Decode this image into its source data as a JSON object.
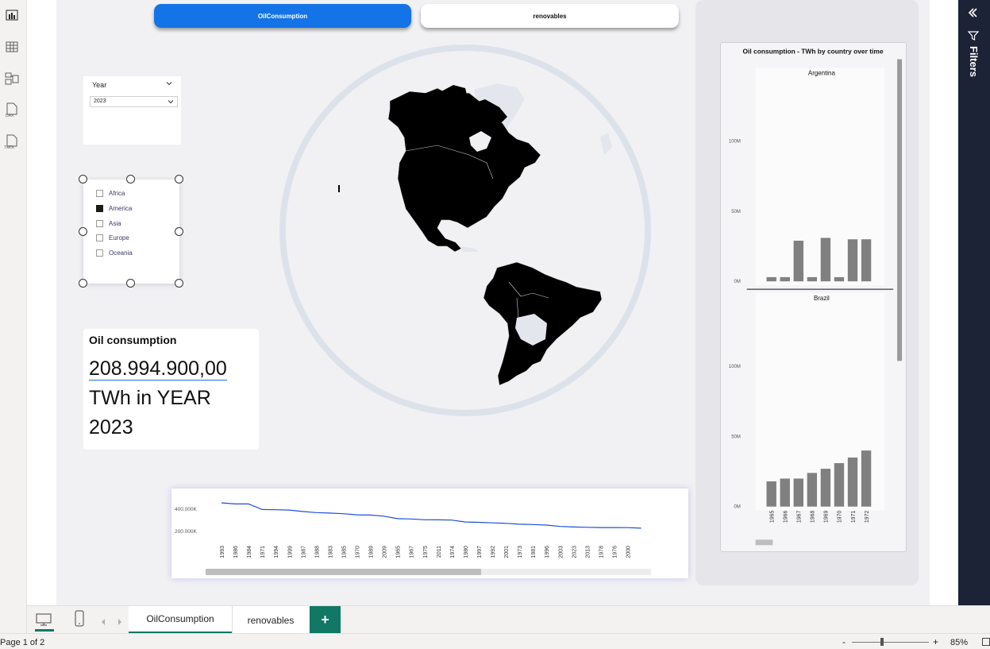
{
  "nav": {
    "active_tab": "OilConsumption",
    "other_tab": "renovables"
  },
  "slicer_year": {
    "title": "Year",
    "selected": "2023"
  },
  "slicer_region": {
    "items": [
      {
        "label": "Africa",
        "checked": false
      },
      {
        "label": "America",
        "checked": true
      },
      {
        "label": "Asia",
        "checked": false
      },
      {
        "label": "Europe",
        "checked": false
      },
      {
        "label": "Oceania",
        "checked": false
      }
    ]
  },
  "card": {
    "title": "Oil consumption",
    "value": "208.994.900,00",
    "suffix_1": "TWh in YEAR",
    "suffix_2": "2023"
  },
  "filters": {
    "label": "Filters"
  },
  "tabs": {
    "tab1": "OilConsumption",
    "tab2": "renovables",
    "add": "+"
  },
  "status": {
    "page": "Page 1 of 2",
    "zoom": "85%",
    "minus": "-",
    "plus": "+"
  },
  "chart_data": [
    {
      "type": "line",
      "title": "",
      "x": [
        "1993",
        "1986",
        "1984",
        "1971",
        "1994",
        "1999",
        "1987",
        "1988",
        "1983",
        "1985",
        "1970",
        "1989",
        "2009",
        "1965",
        "1967",
        "1975",
        "2011",
        "1974",
        "1980",
        "1997",
        "1992",
        "2001",
        "1973",
        "1981",
        "1996",
        "2003",
        "2023",
        "2013",
        "1978",
        "1976",
        "2000"
      ],
      "y": [
        450000,
        440000,
        440000,
        390000,
        388000,
        385000,
        372000,
        362000,
        358000,
        352000,
        342000,
        340000,
        330000,
        308000,
        305000,
        298000,
        297000,
        295000,
        278000,
        275000,
        270000,
        266000,
        258000,
        255000,
        250000,
        238000,
        233000,
        230000,
        228000,
        228000,
        227000,
        222000
      ],
      "yticks": [
        "400.000K",
        "200.000K"
      ],
      "color": "#1d4fd8"
    },
    {
      "type": "bar",
      "title": "Oil consumption - TWh by country over time",
      "yticks": [
        "100M",
        "50M",
        "0M"
      ],
      "color": "#808080",
      "panels": [
        {
          "name": "Argentina",
          "categories": [
            "1965",
            "1966",
            "1967",
            "1968",
            "1969",
            "1970",
            "1971",
            "1972"
          ],
          "values": [
            3,
            3,
            29,
            3,
            31,
            3,
            30,
            30
          ]
        },
        {
          "name": "Brazil",
          "categories": [
            "1965",
            "1966",
            "1967",
            "1968",
            "1969",
            "1970",
            "1971",
            "1972"
          ],
          "values": [
            18,
            20,
            20,
            24,
            27,
            31,
            35,
            40
          ]
        }
      ],
      "ylim": [
        0,
        150
      ]
    }
  ]
}
